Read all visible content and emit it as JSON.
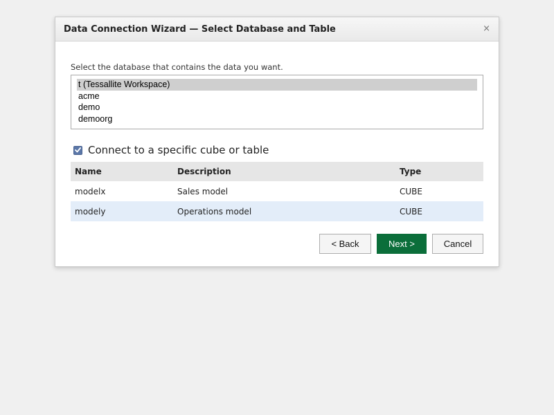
{
  "dialog": {
    "title": "Data Connection Wizard — Select Database and Table",
    "close_glyph": "×"
  },
  "database": {
    "label": "Select the database that contains the data you want.",
    "items": [
      "t (Tessallite Workspace)",
      "acme",
      "demo",
      "demoorg"
    ],
    "selected_index": 0
  },
  "specific": {
    "checked": true,
    "label": "Connect to a specific cube or table"
  },
  "table": {
    "headers": [
      "Name",
      "Description",
      "Type"
    ],
    "rows": [
      [
        "modelx",
        "Sales model",
        "CUBE"
      ],
      [
        "modely",
        "Operations model",
        "CUBE"
      ]
    ]
  },
  "buttons": {
    "back": "< Back",
    "next": "Next >",
    "cancel": "Cancel"
  },
  "colors": {
    "primary": "#0b6e3a",
    "row_highlight": "#e3edf9",
    "checkbox": "#5b77a8"
  }
}
